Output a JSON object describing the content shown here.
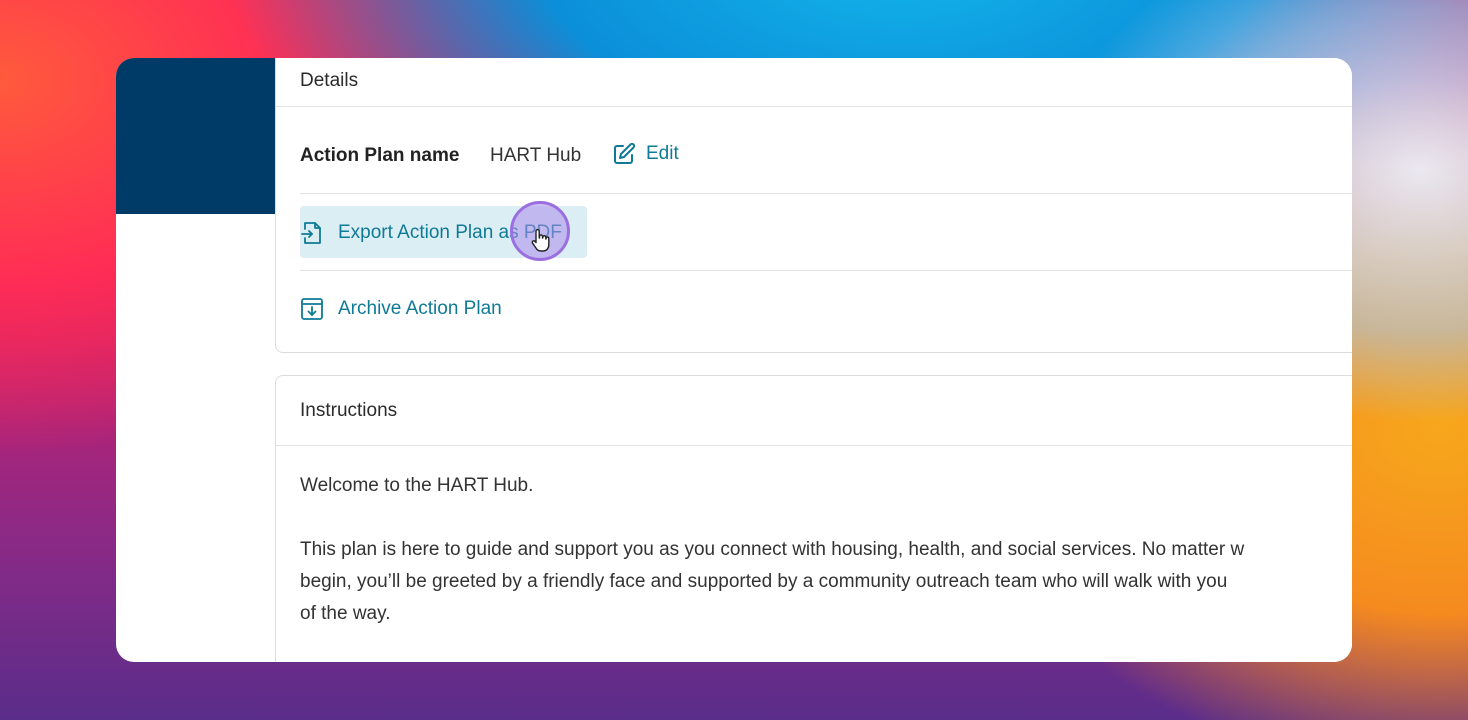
{
  "details": {
    "title": "Details",
    "action_plan_name_label": "Action Plan name",
    "action_plan_name_value": "HART Hub",
    "edit_label": "Edit",
    "export_label": "Export Action Plan as PDF",
    "archive_label": "Archive Action Plan"
  },
  "instructions": {
    "title": "Instructions",
    "welcome": "Welcome to the HART Hub.",
    "body_line1": "This plan is here to guide and support you as you connect with housing, health, and social services. No matter w",
    "body_line2": "begin, you’ll be greeted by a friendly face and supported by a community outreach team who will walk with you",
    "body_line3": "of the way."
  },
  "colors": {
    "accent": "#0f7a96",
    "sidebar": "#003a66",
    "highlight": "#dbeef3"
  },
  "icons": [
    "edit-icon",
    "export-file-icon",
    "archive-icon",
    "hand-pointer-icon"
  ]
}
